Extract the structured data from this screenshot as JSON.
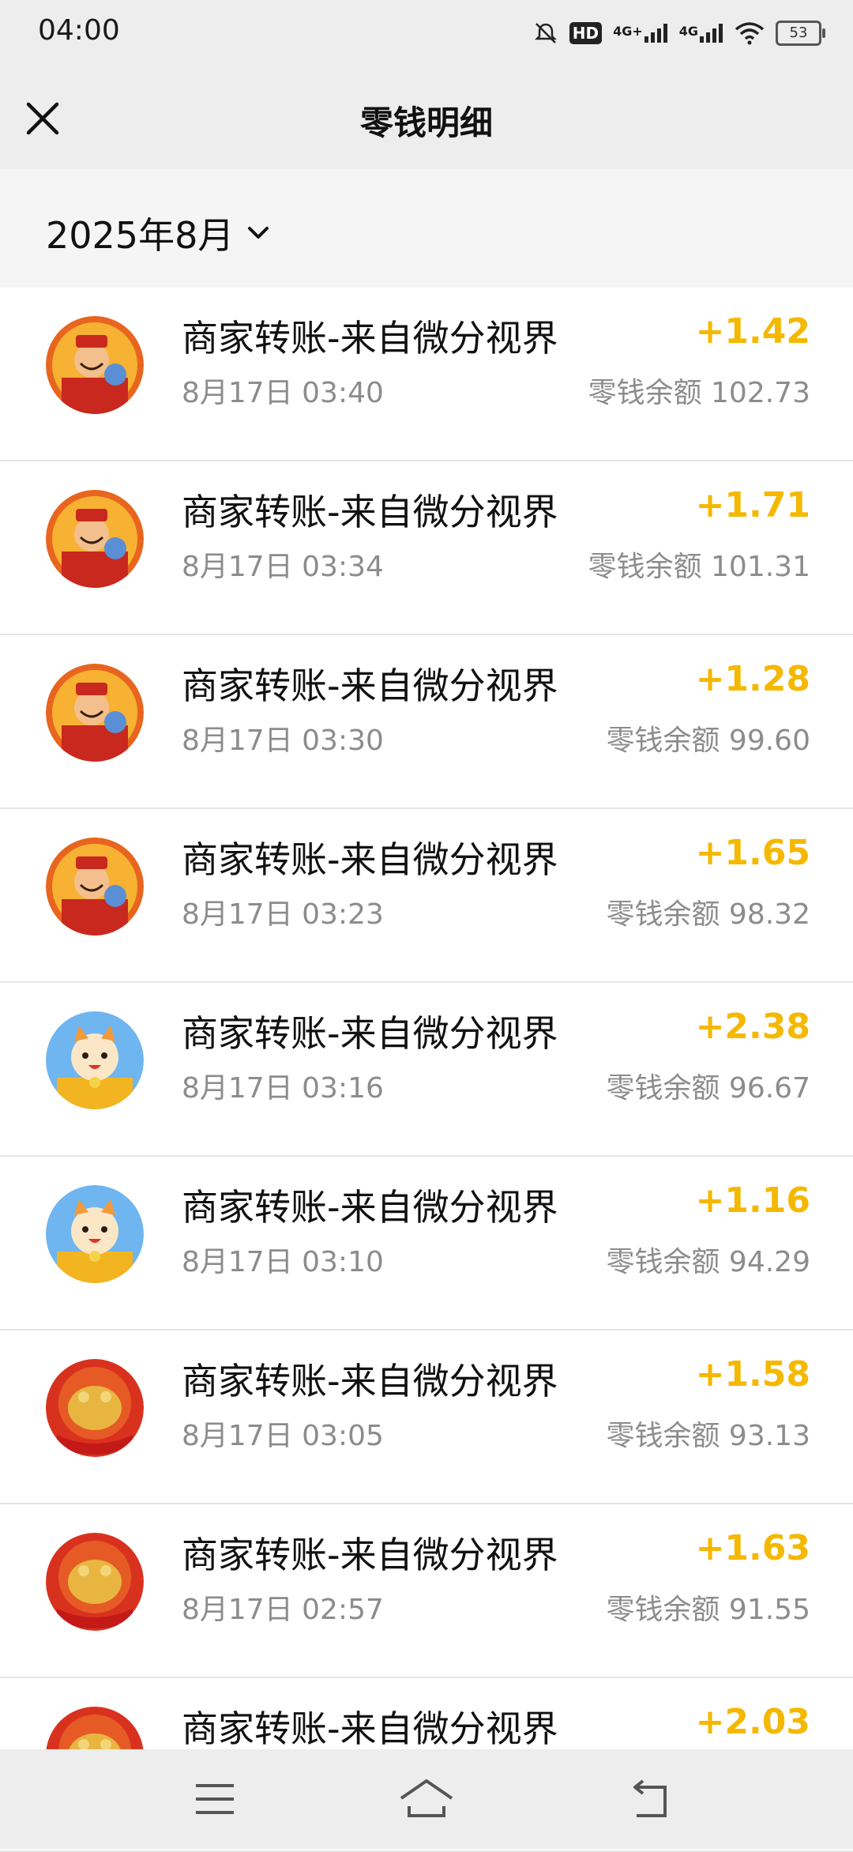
{
  "status_bar": {
    "time": "04:00",
    "hd_label": "HD",
    "signal1_label": "4G+",
    "signal2_label": "4G",
    "battery": "53",
    "icons": [
      "mute-bell-icon",
      "hd-icon",
      "signal-icon",
      "signal-icon",
      "wifi-icon",
      "battery-icon"
    ]
  },
  "header": {
    "title": "零钱明细",
    "close_icon": "close-icon"
  },
  "month_filter": {
    "label": "2025年8月",
    "icon": "chevron-down-icon"
  },
  "colors": {
    "amount": "#f5b800",
    "secondary_text": "#8c8c8c",
    "background": "#ededed"
  },
  "transactions": [
    {
      "title": "商家转账-来自微分视界",
      "time": "8月17日 03:40",
      "amount": "+1.42",
      "balance": "零钱余额 102.73",
      "avatar": "god-of-wealth"
    },
    {
      "title": "商家转账-来自微分视界",
      "time": "8月17日 03:34",
      "amount": "+1.71",
      "balance": "零钱余额 101.31",
      "avatar": "god-of-wealth"
    },
    {
      "title": "商家转账-来自微分视界",
      "time": "8月17日 03:30",
      "amount": "+1.28",
      "balance": "零钱余额 99.60",
      "avatar": "god-of-wealth"
    },
    {
      "title": "商家转账-来自微分视界",
      "time": "8月17日 03:23",
      "amount": "+1.65",
      "balance": "零钱余额 98.32",
      "avatar": "god-of-wealth"
    },
    {
      "title": "商家转账-来自微分视界",
      "time": "8月17日 03:16",
      "amount": "+2.38",
      "balance": "零钱余额 96.67",
      "avatar": "lucky-cat"
    },
    {
      "title": "商家转账-来自微分视界",
      "time": "8月17日 03:10",
      "amount": "+1.16",
      "balance": "零钱余额 94.29",
      "avatar": "lucky-cat"
    },
    {
      "title": "商家转账-来自微分视界",
      "time": "8月17日 03:05",
      "amount": "+1.58",
      "balance": "零钱余额 93.13",
      "avatar": "golden-toad"
    },
    {
      "title": "商家转账-来自微分视界",
      "time": "8月17日 02:57",
      "amount": "+1.63",
      "balance": "零钱余额 91.55",
      "avatar": "golden-toad"
    },
    {
      "title": "商家转账-来自微分视界",
      "time": "",
      "amount": "+2.03",
      "balance": "",
      "avatar": "golden-toad"
    }
  ],
  "nav_bar": {
    "icons": [
      "menu-icon",
      "home-icon",
      "back-icon"
    ]
  }
}
